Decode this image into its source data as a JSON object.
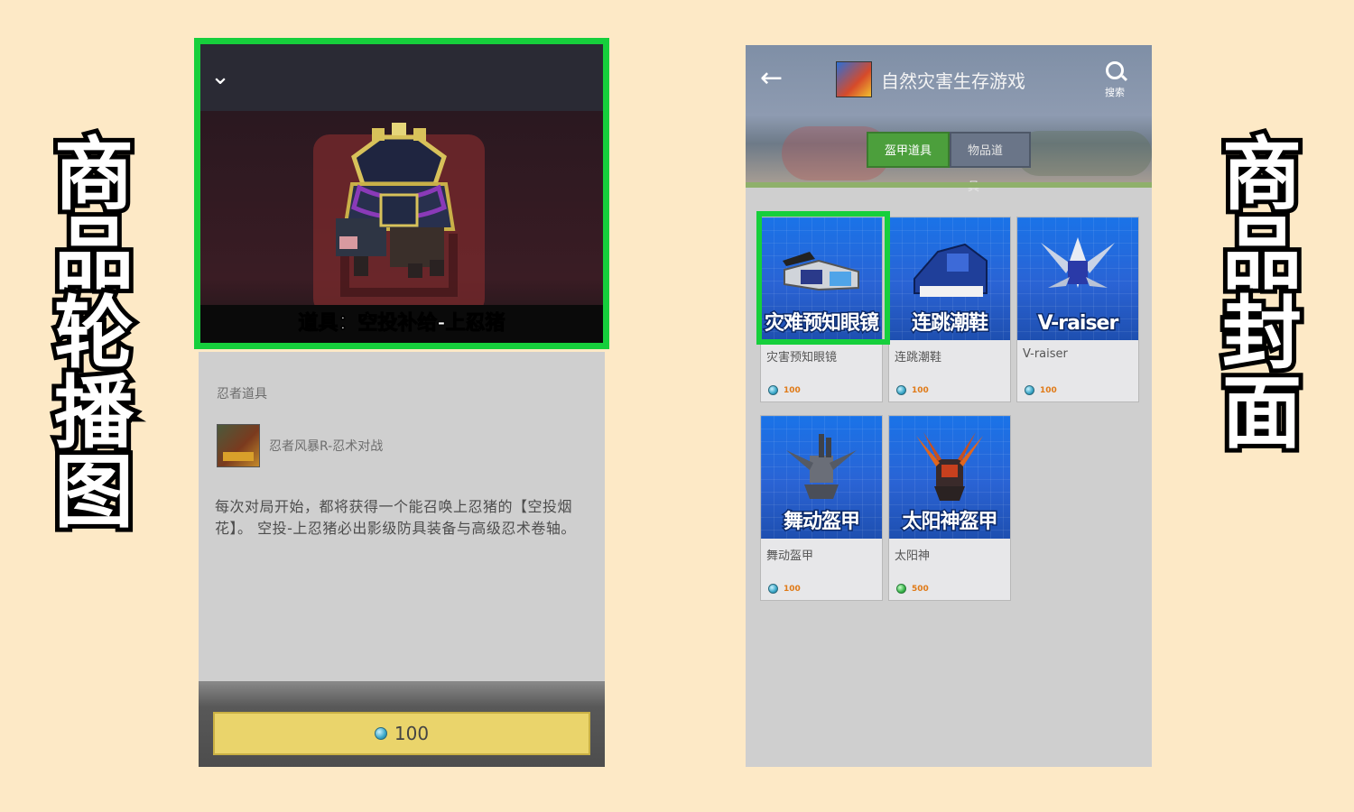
{
  "labels": {
    "left": [
      "商",
      "品",
      "轮",
      "播",
      "图"
    ],
    "right": [
      "商",
      "品",
      "封",
      "面"
    ]
  },
  "detail": {
    "collapse_icon": "chevron-down-icon",
    "carousel_caption": "道具：空投补给-上忍猪",
    "category": "忍者道具",
    "game_name": "忍者风暴R-忍术对战",
    "description": "每次对局开始，都将获得一个能召唤上忍猪的【空投烟花】。 空投-上忍猪必出影级防具装备与高级忍术卷轴。",
    "buy_price": "100"
  },
  "shop": {
    "back_icon": "arrow-left-icon",
    "title": "自然灾害生存游戏",
    "search_label": "搜索",
    "tabs": [
      "盔甲道具",
      "物品道具"
    ],
    "active_tab": "盔甲道具",
    "items": [
      {
        "cover_title": "灾难预知眼镜",
        "name": "灾害预知眼镜",
        "price": "100",
        "gem": "blue"
      },
      {
        "cover_title": "连跳潮鞋",
        "name": "连跳潮鞋",
        "price": "100",
        "gem": "blue"
      },
      {
        "cover_title": "V-raiser",
        "name": "V-raiser",
        "price": "100",
        "gem": "blue"
      },
      {
        "cover_title": "舞动盔甲",
        "name": "舞动盔甲",
        "price": "100",
        "gem": "blue"
      },
      {
        "cover_title": "太阳神盔甲",
        "name": "太阳神",
        "price": "500",
        "gem": "green"
      }
    ]
  },
  "colors": {
    "background": "#fde9c6",
    "highlight": "#16cf3c",
    "buy_button": "#ead46b",
    "active_tab": "#4c9f3c",
    "price_text": "#e07a17"
  }
}
